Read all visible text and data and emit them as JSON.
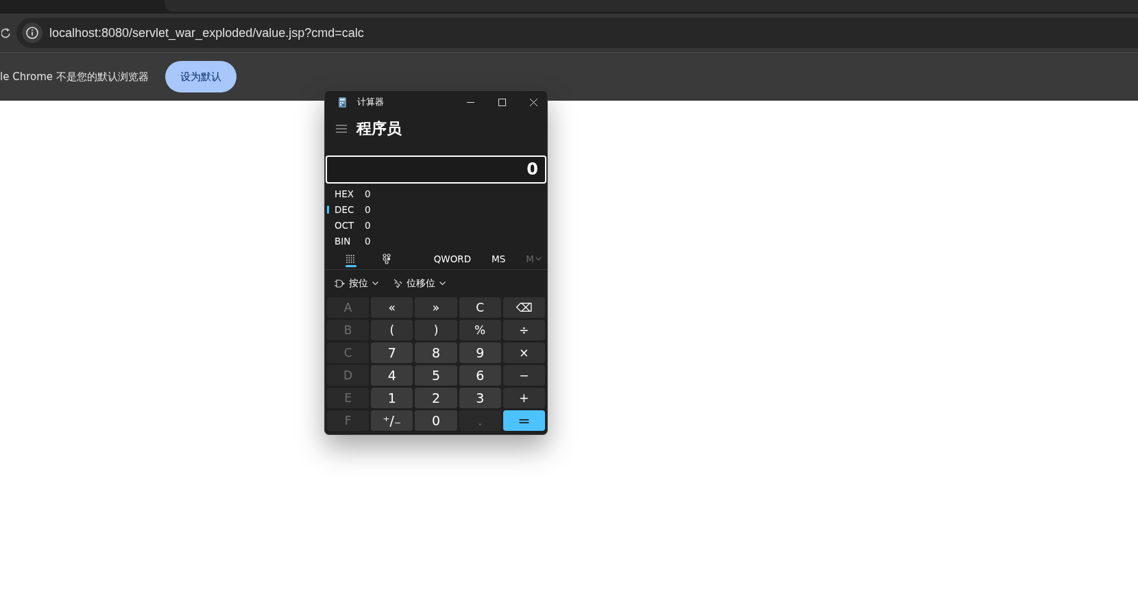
{
  "browser": {
    "address": "localhost:8080/servlet_war_exploded/value.jsp?cmd=calc",
    "infobar": {
      "message": "le Chrome 不是您的默认浏览器",
      "button": "设为默认"
    }
  },
  "calculator": {
    "title": "计算器",
    "mode": "程序员",
    "display": "0",
    "radix": [
      {
        "label": "HEX",
        "value": "0",
        "selected": false
      },
      {
        "label": "DEC",
        "value": "0",
        "selected": true
      },
      {
        "label": "OCT",
        "value": "0",
        "selected": false
      },
      {
        "label": "BIN",
        "value": "0",
        "selected": false
      }
    ],
    "toolbar": [
      {
        "kind": "keypad",
        "selected": true
      },
      {
        "kind": "bits",
        "selected": false
      },
      {
        "kind": "text",
        "label": "QWORD",
        "disabled": false
      },
      {
        "kind": "text",
        "label": "MS",
        "disabled": false
      },
      {
        "kind": "menu",
        "label": "M",
        "disabled": true
      }
    ],
    "dropdowns": [
      {
        "kind": "bitwise",
        "label": "按位"
      },
      {
        "kind": "shift",
        "label": "位移位"
      }
    ],
    "keys": [
      {
        "label": "A",
        "kind": "hex",
        "disabled": true
      },
      {
        "label": "«",
        "kind": "op",
        "disabled": false
      },
      {
        "label": "»",
        "kind": "op",
        "disabled": false
      },
      {
        "label": "C",
        "kind": "op",
        "disabled": false
      },
      {
        "label": "⌫",
        "kind": "op",
        "disabled": false
      },
      {
        "label": "B",
        "kind": "hex",
        "disabled": true
      },
      {
        "label": "(",
        "kind": "op",
        "disabled": false
      },
      {
        "label": ")",
        "kind": "op",
        "disabled": false
      },
      {
        "label": "%",
        "kind": "op",
        "disabled": false
      },
      {
        "label": "÷",
        "kind": "op",
        "disabled": false
      },
      {
        "label": "C",
        "kind": "hex",
        "disabled": true
      },
      {
        "label": "7",
        "kind": "num",
        "disabled": false
      },
      {
        "label": "8",
        "kind": "num",
        "disabled": false
      },
      {
        "label": "9",
        "kind": "num",
        "disabled": false
      },
      {
        "label": "×",
        "kind": "op",
        "disabled": false
      },
      {
        "label": "D",
        "kind": "hex",
        "disabled": true
      },
      {
        "label": "4",
        "kind": "num",
        "disabled": false
      },
      {
        "label": "5",
        "kind": "num",
        "disabled": false
      },
      {
        "label": "6",
        "kind": "num",
        "disabled": false
      },
      {
        "label": "−",
        "kind": "op",
        "disabled": false
      },
      {
        "label": "E",
        "kind": "hex",
        "disabled": true
      },
      {
        "label": "1",
        "kind": "num",
        "disabled": false
      },
      {
        "label": "2",
        "kind": "num",
        "disabled": false
      },
      {
        "label": "3",
        "kind": "num",
        "disabled": false
      },
      {
        "label": "+",
        "kind": "op",
        "disabled": false
      },
      {
        "label": "F",
        "kind": "hex",
        "disabled": true
      },
      {
        "label": "⁺/₋",
        "kind": "num",
        "disabled": false
      },
      {
        "label": "0",
        "kind": "num",
        "disabled": false
      },
      {
        "label": ".",
        "kind": "num",
        "disabled": true
      },
      {
        "label": "=",
        "kind": "equals",
        "disabled": false
      }
    ]
  }
}
